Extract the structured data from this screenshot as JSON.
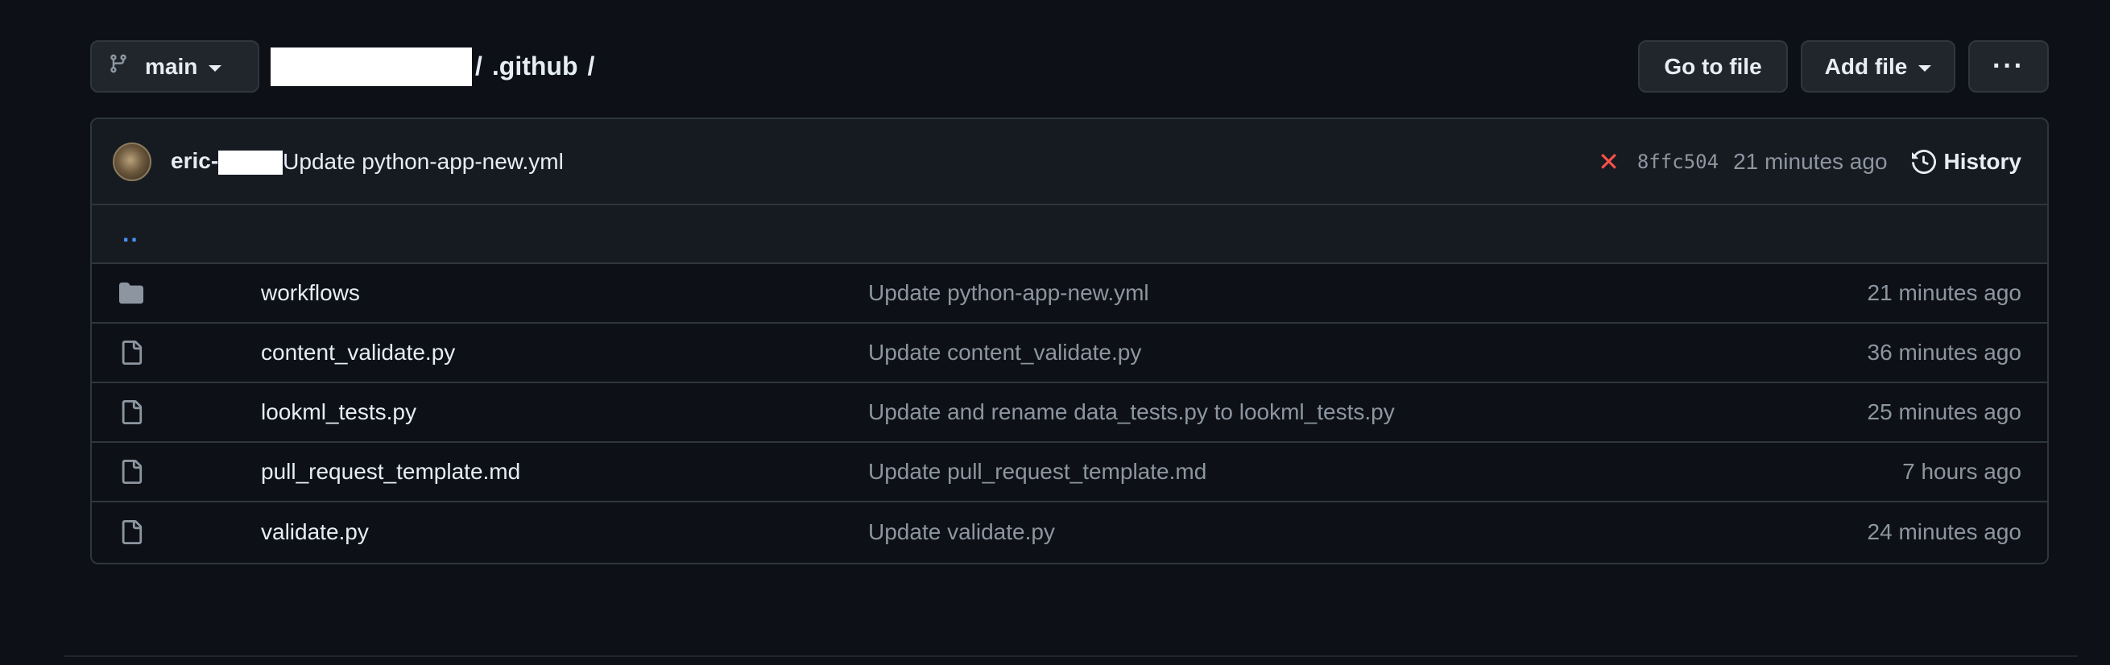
{
  "toolbar": {
    "branch": "main",
    "path_dir": ".github",
    "path_sep": "/",
    "go_to_file": "Go to file",
    "add_file": "Add file",
    "more": "···"
  },
  "commit": {
    "author": "eric-",
    "message": "Update python-app-new.yml",
    "status_icon": "x-icon",
    "sha": "8ffc504",
    "time": "21 minutes ago",
    "history_label": "History"
  },
  "up_dir": "..",
  "files": [
    {
      "type": "folder",
      "name": "workflows",
      "commit": "Update python-app-new.yml",
      "time": "21 minutes ago"
    },
    {
      "type": "file",
      "name": "content_validate.py",
      "commit": "Update content_validate.py",
      "time": "36 minutes ago"
    },
    {
      "type": "file",
      "name": "lookml_tests.py",
      "commit": "Update and rename data_tests.py to lookml_tests.py",
      "time": "25 minutes ago"
    },
    {
      "type": "file",
      "name": "pull_request_template.md",
      "commit": "Update pull_request_template.md",
      "time": "7 hours ago"
    },
    {
      "type": "file",
      "name": "validate.py",
      "commit": "Update validate.py",
      "time": "24 minutes ago"
    }
  ],
  "colors": {
    "background": "#0d1117",
    "panel": "#161b22",
    "border": "#30363d",
    "link": "#4493f8",
    "failure": "#f85149"
  }
}
